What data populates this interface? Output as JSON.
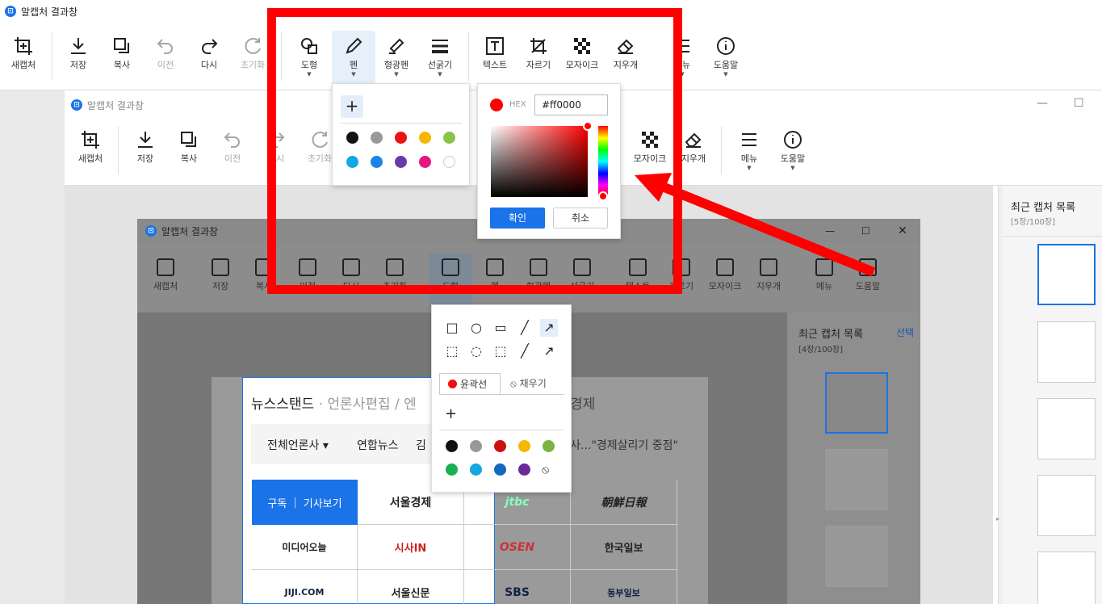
{
  "outer": {
    "title": "알캡처 결과창",
    "tools": [
      {
        "label": "새캡처"
      },
      {
        "label": "저장"
      },
      {
        "label": "복사"
      },
      {
        "label": "이전"
      },
      {
        "label": "다시"
      },
      {
        "label": "초기화"
      },
      {
        "label": "도형"
      },
      {
        "label": "펜"
      },
      {
        "label": "형광펜"
      },
      {
        "label": "선굵기"
      },
      {
        "label": "텍스트"
      },
      {
        "label": "자르기"
      },
      {
        "label": "모자이크"
      },
      {
        "label": "지우개"
      },
      {
        "label": "메뉴"
      },
      {
        "label": "도움말"
      }
    ]
  },
  "inner": {
    "title": "알캡처 결과창",
    "tools": [
      {
        "label": "새캡처"
      },
      {
        "label": "저장"
      },
      {
        "label": "복사"
      },
      {
        "label": "이전"
      },
      {
        "label": "다시"
      },
      {
        "label": "초기화"
      },
      {
        "label": "모자이크"
      },
      {
        "label": "지우개"
      },
      {
        "label": "메뉴"
      },
      {
        "label": "도움말"
      }
    ],
    "sidebar_title": "최근 캡처 목록",
    "sidebar_count": "[5장/100장]"
  },
  "color_picker": {
    "hex_label": "HEX",
    "hex_value": "#ff0000",
    "ok": "확인",
    "cancel": "취소",
    "selected_color": "#ff0000"
  },
  "pen_palette": {
    "add": "+",
    "colors": [
      "#111111",
      "#999999",
      "#ee1111",
      "#f5b800",
      "#8bc34a",
      "#12a8e6",
      "#1a84e8",
      "#6a3aa8",
      "#e8167f",
      "#ffffff"
    ]
  },
  "screenshot": {
    "title": "알캡처 결과창",
    "tools": [
      {
        "label": "새캡처"
      },
      {
        "label": "저장"
      },
      {
        "label": "복사"
      },
      {
        "label": "이전"
      },
      {
        "label": "다시"
      },
      {
        "label": "초기화"
      },
      {
        "label": "도형"
      },
      {
        "label": "펜"
      },
      {
        "label": "형광펜"
      },
      {
        "label": "선굵기"
      },
      {
        "label": "텍스트"
      },
      {
        "label": "자르기"
      },
      {
        "label": "모자이크"
      },
      {
        "label": "지우개"
      },
      {
        "label": "메뉴"
      },
      {
        "label": "도움말"
      }
    ],
    "sidebar_title": "최근 캡처 목록",
    "sidebar_select": "선택",
    "sidebar_count": "[4장/100장]",
    "shape_tabs": {
      "outline": "윤곽선",
      "fill": "채우기"
    },
    "shape_add": "+",
    "shape_colors": [
      "#111111",
      "#999999",
      "#cc1111",
      "#f5b800",
      "#7cb342",
      "#18b050",
      "#14a8e0",
      "#1466c0",
      "#6a2a9a"
    ]
  },
  "webpage": {
    "news_title": "뉴스스탠드",
    "news_sub1": "언론사편집",
    "news_sub2": "엔",
    "news_sub3": "경제",
    "filter_all": "전체언론사",
    "filter_yonhap": "연합뉴스",
    "filter_kim": "김",
    "headline": "결 특사...\"경제살리기 중점\"",
    "subscribe": "구독",
    "view_articles": "기사보기",
    "press": [
      "서울경제",
      "jtbc",
      "朝鮮日報",
      "미디어오늘",
      "시사IN",
      "OSEN",
      "한국일보",
      "JIJI.COM",
      "서울신문",
      "SBS",
      "동부일보"
    ]
  }
}
